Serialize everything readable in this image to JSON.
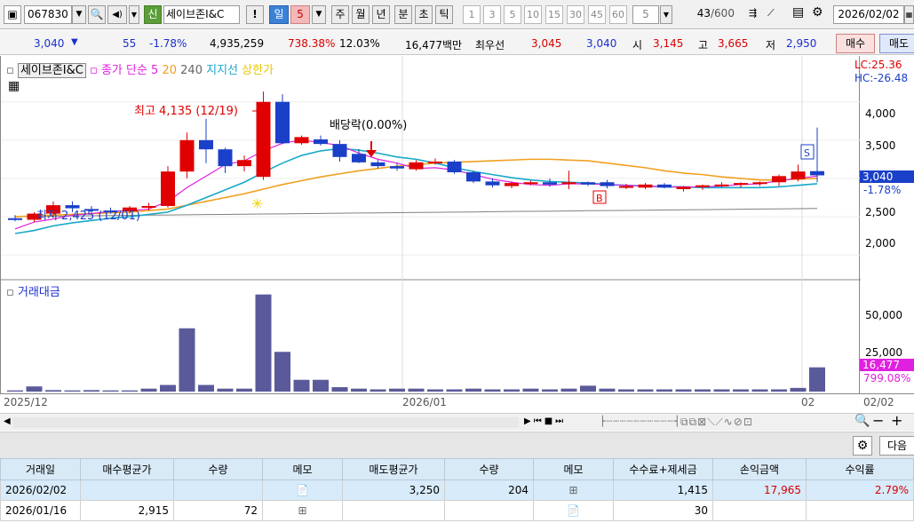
{
  "toolbar": {
    "code": "067830",
    "name": "세이브존I&C",
    "badge": "신",
    "excl": "!",
    "period_day": "일",
    "period_num": "5",
    "periods": [
      "주",
      "월",
      "년",
      "분",
      "초",
      "틱"
    ],
    "nums": [
      "1",
      "3",
      "5",
      "10",
      "15",
      "30",
      "45",
      "60"
    ],
    "count_sel": "5",
    "count": "43",
    "count_max": "/600",
    "date": "2026/02/02"
  },
  "quote": {
    "price": "3,040",
    "change": "55",
    "change_pct": "-1.78%",
    "volume": "4,935,259",
    "vol_ratio": "738.38%",
    "turnover": "12.03%",
    "amount": "16,477백만",
    "best_label": "최우선",
    "best_ask": "3,045",
    "best_bid": "3,040",
    "open_label": "시",
    "open": "3,145",
    "high_label": "고",
    "high": "3,665",
    "low_label": "저",
    "low": "2,950",
    "buy_btn": "매수",
    "sell_btn": "매도"
  },
  "chart": {
    "legend_name": "세이브존I&C",
    "legend_close": "종가 단순 5",
    "legend_ma20": "20",
    "legend_ma240": "240",
    "legend_support": "지지선",
    "legend_upper": "상한가",
    "lc": "LC:25.36",
    "hc": "HC:-26.48",
    "yticks": [
      "4,000",
      "3,500",
      "3,000",
      "2,500",
      "2,000"
    ],
    "price_tag": "3,040",
    "pct_tag": "-1.78%",
    "high_note": "최고 4,135 (12/19)",
    "low_note": "최저 2,425 (12/01)",
    "div_note": "배당락(0.00%)",
    "marker_b": "B",
    "marker_s": "S",
    "vol_legend": "거래대금",
    "vol_ticks": [
      "50,000",
      "25,000"
    ],
    "vol_tag": "16,477",
    "vol_pct": "799.08%"
  },
  "dates": {
    "d1": "2025/12",
    "d2": "2026/01",
    "d3": "02",
    "d4": "02/02"
  },
  "panel": {
    "next": "다음"
  },
  "table": {
    "headers": [
      "거래일",
      "매수평균가",
      "수량",
      "메모",
      "매도평균가",
      "수량",
      "메모",
      "수수료+제세금",
      "손익금액",
      "수익률"
    ],
    "rows": [
      [
        "2026/02/02",
        "",
        "",
        "",
        "3,250",
        "204",
        "",
        "1,415",
        "17,965",
        "2.79%"
      ],
      [
        "2026/01/16",
        "2,915",
        "72",
        "",
        "",
        "",
        "",
        "30",
        "",
        ""
      ]
    ]
  },
  "colors": {
    "up": "#e00000",
    "down": "#1a3fc8",
    "ma5": "#e020e0",
    "ma20": "#18a8c8",
    "ma60": "#f0a020",
    "ma240": "#808080",
    "vol": "#5a5a9a"
  },
  "chart_data": {
    "type": "candlestick",
    "candles": [
      [
        2480,
        2520,
        2440,
        2470
      ],
      [
        2460,
        2560,
        2430,
        2540
      ],
      [
        2540,
        2700,
        2500,
        2650
      ],
      [
        2650,
        2700,
        2560,
        2610
      ],
      [
        2600,
        2640,
        2550,
        2580
      ],
      [
        2580,
        2620,
        2540,
        2570
      ],
      [
        2570,
        2640,
        2540,
        2620
      ],
      [
        2620,
        2680,
        2580,
        2640
      ],
      [
        2640,
        3160,
        2620,
        3090
      ],
      [
        3090,
        3600,
        3000,
        3500
      ],
      [
        3500,
        3780,
        3200,
        3380
      ],
      [
        3380,
        3400,
        3070,
        3160
      ],
      [
        3160,
        3300,
        3090,
        3240
      ],
      [
        3020,
        4135,
        2980,
        4000
      ],
      [
        4000,
        4100,
        3450,
        3460
      ],
      [
        3460,
        3560,
        3440,
        3540
      ],
      [
        3510,
        3560,
        3430,
        3450
      ],
      [
        3450,
        3500,
        3220,
        3280
      ],
      [
        3320,
        3380,
        3200,
        3210
      ],
      [
        3210,
        3240,
        3130,
        3160
      ],
      [
        3160,
        3200,
        3100,
        3130
      ],
      [
        3120,
        3240,
        3100,
        3210
      ],
      [
        3210,
        3260,
        3180,
        3220
      ],
      [
        3220,
        3240,
        3060,
        3080
      ],
      [
        3080,
        3100,
        2940,
        2960
      ],
      [
        2960,
        3000,
        2880,
        2910
      ],
      [
        2900,
        2960,
        2870,
        2940
      ],
      [
        2940,
        2970,
        2910,
        2950
      ],
      [
        2950,
        3000,
        2890,
        2920
      ],
      [
        2930,
        3100,
        2860,
        2950
      ],
      [
        2950,
        2960,
        2900,
        2920
      ],
      [
        2950,
        2980,
        2870,
        2900
      ],
      [
        2880,
        2930,
        2860,
        2900
      ],
      [
        2880,
        2940,
        2860,
        2920
      ],
      [
        2920,
        2940,
        2870,
        2880
      ],
      [
        2860,
        2900,
        2830,
        2890
      ],
      [
        2890,
        2920,
        2850,
        2910
      ],
      [
        2910,
        2950,
        2880,
        2920
      ],
      [
        2920,
        2950,
        2880,
        2940
      ],
      [
        2940,
        2960,
        2900,
        2950
      ],
      [
        2950,
        3050,
        2900,
        3030
      ],
      [
        2990,
        3180,
        2960,
        3090
      ],
      [
        3095,
        3665,
        2950,
        3040
      ]
    ],
    "ma5": [
      2340,
      2430,
      2470,
      2520,
      2540,
      2570,
      2580,
      2600,
      2700,
      2880,
      3030,
      3180,
      3230,
      3360,
      3460,
      3500,
      3470,
      3430,
      3330,
      3250,
      3200,
      3130,
      3140,
      3110,
      3050,
      2990,
      2950,
      2920,
      2910,
      2930,
      2930,
      2920,
      2910,
      2900,
      2890,
      2890,
      2890,
      2900,
      2920,
      2930,
      2970,
      3000,
      3030
    ],
    "ma20": [
      2280,
      2320,
      2380,
      2420,
      2450,
      2480,
      2500,
      2530,
      2560,
      2650,
      2750,
      2850,
      2950,
      3080,
      3200,
      3300,
      3360,
      3390,
      3370,
      3330,
      3280,
      3250,
      3200,
      3140,
      3090,
      3050,
      3010,
      2980,
      2960,
      2950,
      2940,
      2920,
      2910,
      2900,
      2890,
      2890,
      2880,
      2880,
      2880,
      2880,
      2890,
      2910,
      2930
    ],
    "ma60": [
      2500,
      2510,
      2520,
      2530,
      2540,
      2550,
      2560,
      2580,
      2600,
      2650,
      2700,
      2750,
      2800,
      2860,
      2920,
      2970,
      3020,
      3060,
      3100,
      3130,
      3160,
      3180,
      3200,
      3210,
      3220,
      3230,
      3240,
      3250,
      3250,
      3240,
      3230,
      3200,
      3170,
      3140,
      3100,
      3070,
      3050,
      3020,
      3000,
      2980,
      2980,
      2990,
      3000
    ],
    "ma240": [
      2500,
      2500,
      2505,
      2510,
      2512,
      2515,
      2518,
      2520,
      2522,
      2525,
      2528,
      2530,
      2532,
      2535,
      2537,
      2540,
      2542,
      2545,
      2548,
      2550,
      2552,
      2555,
      2557,
      2560,
      2562,
      2565,
      2568,
      2570,
      2572,
      2575,
      2578,
      2580,
      2582,
      2585,
      2587,
      2590,
      2592,
      2595,
      2597,
      2600,
      2602,
      2605,
      2607
    ],
    "volume": [
      800,
      3500,
      1000,
      800,
      1000,
      800,
      800,
      2000,
      4500,
      43000,
      4500,
      2000,
      2000,
      66000,
      27000,
      8000,
      8000,
      3000,
      2000,
      1500,
      2000,
      2000,
      1500,
      1500,
      2000,
      1500,
      1500,
      2000,
      1500,
      2000,
      4000,
      2000,
      1500,
      1500,
      1500,
      1500,
      1500,
      1500,
      1500,
      1500,
      1500,
      2500,
      16477
    ],
    "ylim": [
      1700,
      4600
    ],
    "vol_ylim": [
      0,
      70000
    ]
  }
}
